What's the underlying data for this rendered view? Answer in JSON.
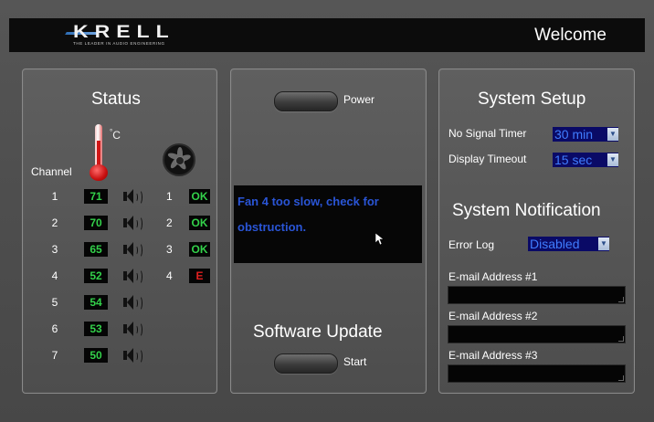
{
  "header": {
    "logo_text": "KRELL",
    "logo_tagline": "THE LEADER IN AUDIO ENGINEERING",
    "welcome": "Welcome"
  },
  "status": {
    "title": "Status",
    "temp_unit": "C",
    "channel_label": "Channel",
    "channels": [
      {
        "num": "1",
        "temp": "71"
      },
      {
        "num": "2",
        "temp": "70"
      },
      {
        "num": "3",
        "temp": "65"
      },
      {
        "num": "4",
        "temp": "52"
      },
      {
        "num": "5",
        "temp": "54"
      },
      {
        "num": "6",
        "temp": "53"
      },
      {
        "num": "7",
        "temp": "50"
      }
    ],
    "fans": [
      {
        "num": "1",
        "status": "OK",
        "color": "#33d14a"
      },
      {
        "num": "2",
        "status": "OK",
        "color": "#33d14a"
      },
      {
        "num": "3",
        "status": "OK",
        "color": "#33d14a"
      },
      {
        "num": "4",
        "status": "E",
        "color": "#e02020"
      }
    ],
    "icons": {
      "thermometer": "thermometer-icon",
      "fan": "fan-icon",
      "speaker": "speaker-icon"
    }
  },
  "center": {
    "power_label": "Power",
    "message": "Fan 4 too slow, check for obstruction.",
    "message_color": "#2a55d6",
    "software_update_title": "Software Update",
    "start_label": "Start"
  },
  "setup": {
    "title": "System Setup",
    "no_signal_timer_label": "No Signal Timer",
    "no_signal_timer_value": "30 min",
    "display_timeout_label": "Display Timeout",
    "display_timeout_value": "15 sec",
    "notification_title": "System Notification",
    "error_log_label": "Error Log",
    "error_log_value": "Disabled",
    "email1_label": "E-mail Address #1",
    "email1_value": "",
    "email2_label": "E-mail Address #2",
    "email2_value": "",
    "email3_label": "E-mail Address #3",
    "email3_value": ""
  },
  "colors": {
    "background": "#505050",
    "temp_text": "#33d14a",
    "select_bg": "#0a0a66",
    "select_text": "#3f7dff"
  }
}
